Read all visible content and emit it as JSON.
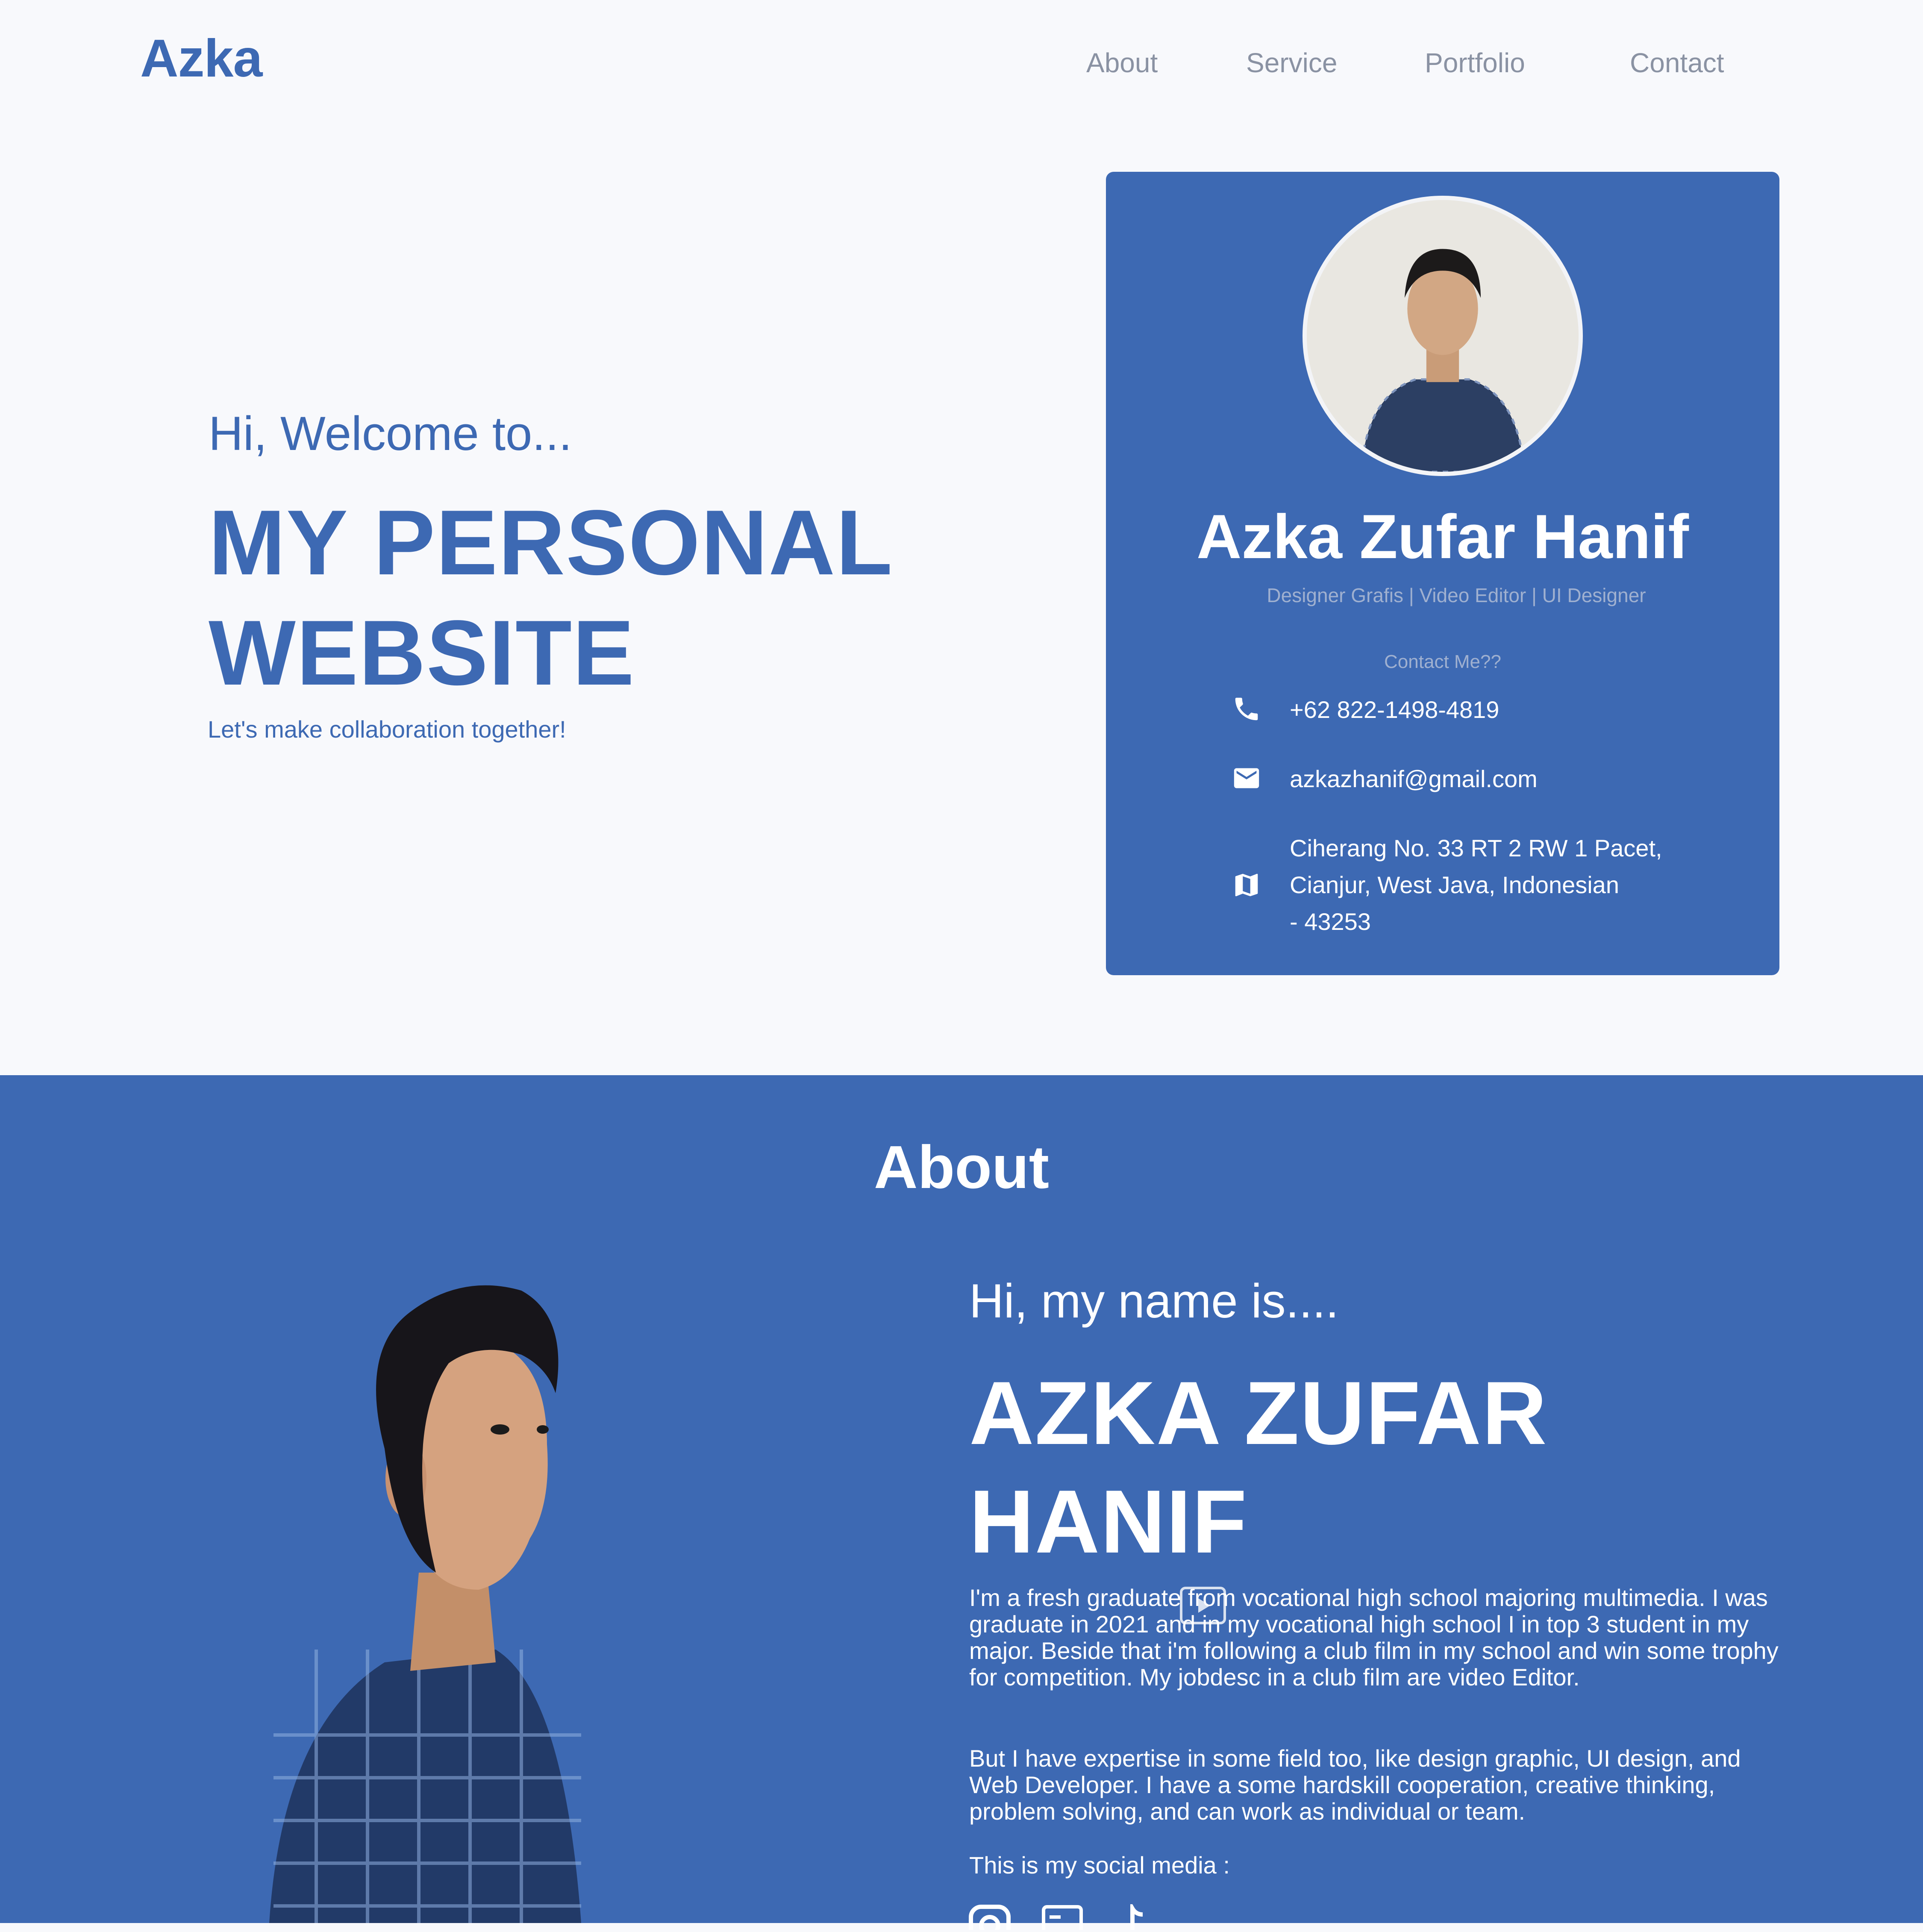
{
  "header": {
    "logo": "Azka",
    "nav": [
      "About",
      "Service",
      "Portfolio",
      "Contact"
    ]
  },
  "hero": {
    "welcome": "Hi, Welcome to...",
    "title_line1": "MY PERSONAL",
    "title_line2": "WEBSITE",
    "subtitle": "Let's make collaboration together!"
  },
  "card": {
    "name": "Azka Zufar Hanif",
    "role": "Designer Grafis | Video Editor | UI Designer",
    "contact_title": "Contact Me??",
    "phone": "+62 822-1498-4819",
    "email": "azkazhanif@gmail.com",
    "address_line1": "Ciherang No. 33 RT 2 RW 1 Pacet,",
    "address_line2": "Cianjur, West Java, Indonesian",
    "address_line3": "- 43253"
  },
  "about": {
    "title": "About",
    "hi": "Hi, my name is....",
    "name_line1": "AZKA ZUFAR",
    "name_line2": "HANIF",
    "paragraph1": "I'm a fresh graduate from vocational high school majoring multimedia. I was graduate in 2021 and in my vocational high school I in top 3 student in my major. Beside that i'm following a club film in my school and win some trophy for competition. My jobdesc in a club film are video Editor.",
    "paragraph2": "But I have expertise in some field too, like design graphic, UI design, and Web Developer. I have a some hardskill cooperation, creative thinking, problem solving, and can work as individual or team.",
    "social_label": "This is my social media :",
    "social_icons": [
      "instagram-icon",
      "id-card-icon",
      "tiktok-icon"
    ]
  },
  "colors": {
    "brand": "#3d69b3",
    "background": "#f8f9fc",
    "nav_text": "#8a92a3"
  }
}
